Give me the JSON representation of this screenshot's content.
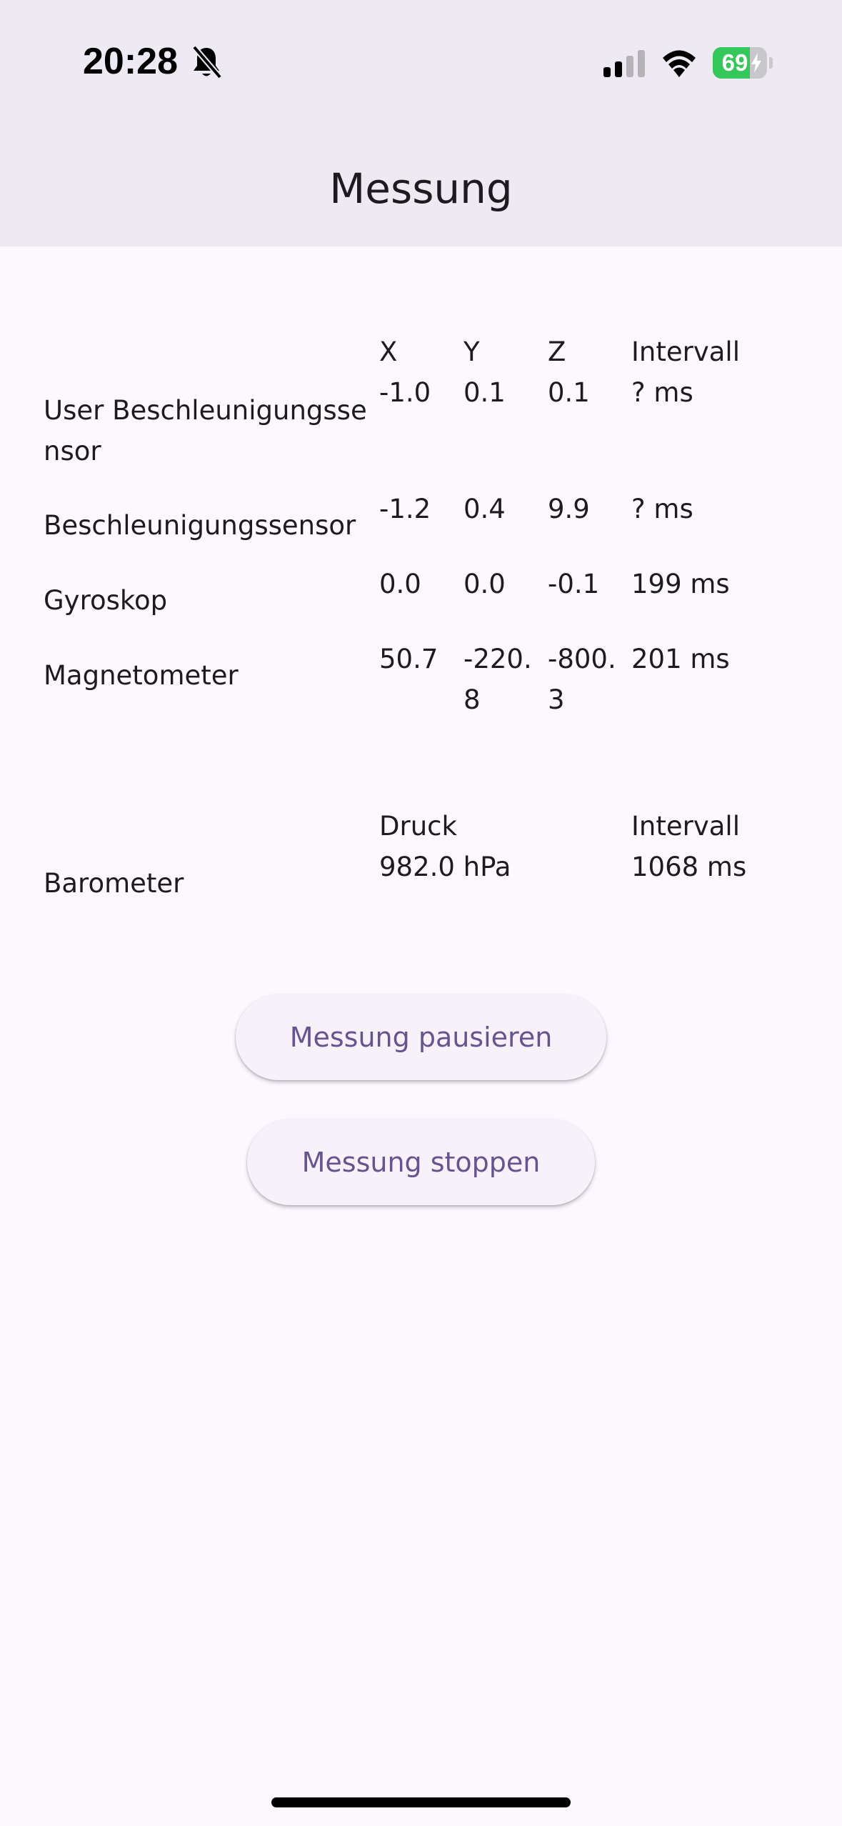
{
  "status_bar": {
    "time": "20:28",
    "battery_level": "69",
    "battery_fraction": 0.69,
    "icons": [
      "bell-slash-icon",
      "cellular-signal-icon",
      "wifi-icon",
      "battery-charging-icon"
    ]
  },
  "header": {
    "title": "Messung"
  },
  "sensors": {
    "columns": {
      "x": "X",
      "y": "Y",
      "z": "Z",
      "interval": "Intervall"
    },
    "rows": [
      {
        "name": "User Beschleunigungssensor",
        "x": "-1.0",
        "y": "0.1",
        "z": "0.1",
        "interval": "? ms"
      },
      {
        "name": "Beschleunigungssensor",
        "x": "-1.2",
        "y": "0.4",
        "z": "9.9",
        "interval": "? ms"
      },
      {
        "name": "Gyroskop",
        "x": "0.0",
        "y": "0.0",
        "z": "-0.1",
        "interval": "199 ms"
      },
      {
        "name": "Magnetometer",
        "x": "50.7",
        "y": "-220.8",
        "z": "-800.3",
        "interval": "201 ms"
      }
    ]
  },
  "barometer": {
    "name": "Barometer",
    "pressure_label": "Druck",
    "pressure_value": "982.0 hPa",
    "interval_label": "Intervall",
    "interval_value": "1068 ms"
  },
  "actions": {
    "pause_label": "Messung pausieren",
    "stop_label": "Messung stoppen"
  },
  "colors": {
    "app_bar": "#eeeaf3",
    "background": "#fdf7fe",
    "button_text": "#65558f",
    "button_bg": "#f7f2fa",
    "battery_green": "#34c759"
  }
}
